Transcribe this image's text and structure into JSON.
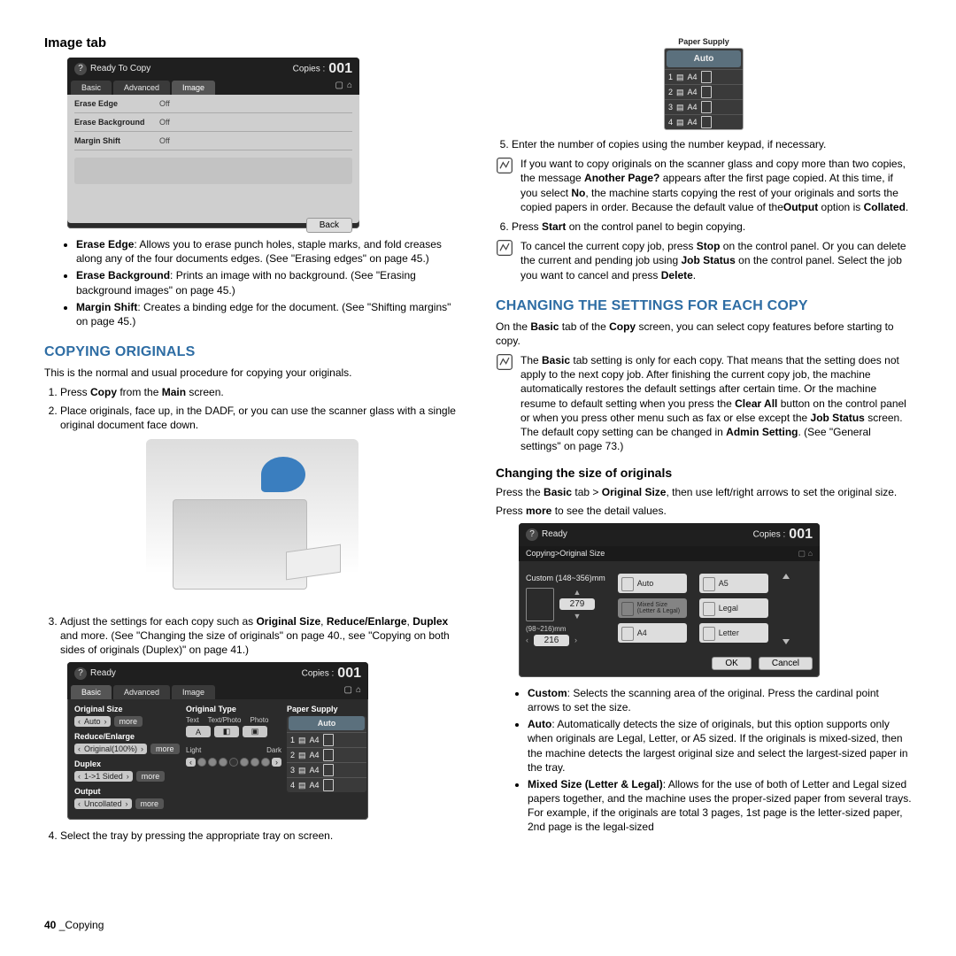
{
  "left": {
    "heading_image_tab": "Image tab",
    "lcd1": {
      "ready": "Ready To Copy",
      "copies_label": "Copies :",
      "copies_num": "001",
      "tab_basic": "Basic",
      "tab_advanced": "Advanced",
      "tab_image": "Image",
      "rows": [
        {
          "lbl": "Erase Edge",
          "val": "Off"
        },
        {
          "lbl": "Erase Background",
          "val": "Off"
        },
        {
          "lbl": "Margin Shift",
          "val": "Off"
        }
      ],
      "back": "Back"
    },
    "bullets_image": [
      {
        "b": "Erase Edge",
        "t": ": Allows you to erase punch holes, staple marks, and fold creases along any of the four documents edges. (See \"Erasing edges\" on page 45.)"
      },
      {
        "b": "Erase Background",
        "t": ": Prints an image with no background. (See \"Erasing background images\" on page 45.)"
      },
      {
        "b": "Margin Shift",
        "t": ": Creates a binding edge for the document. (See \"Shifting margins\" on page 45.)"
      }
    ],
    "heading_copying": "COPYING ORIGINALS",
    "intro_copying": "This is the normal and usual procedure for copying your originals.",
    "step1_a": "Press ",
    "step1_b": "Copy",
    "step1_c": " from the ",
    "step1_d": "Main",
    "step1_e": " screen.",
    "step2": "Place originals, face up, in the DADF, or you can use the scanner glass with a single original document face down.",
    "step3_a": "Adjust the settings for each copy such as ",
    "step3_b": "Original Size",
    "step3_c": ", ",
    "step3_d": "Reduce/Enlarge",
    "step3_e": ", ",
    "step3_f": "Duplex",
    "step3_g": " and more. (See \"Changing the size of originals\" on page 40., see \"Copying on both sides of originals (Duplex)\" on page 41.)",
    "lcd_basic": {
      "ready": "Ready",
      "copies_label": "Copies :",
      "copies_num": "001",
      "tab_basic": "Basic",
      "tab_advanced": "Advanced",
      "tab_image": "Image",
      "g_origsize": "Original Size",
      "v_auto": "Auto",
      "more": "more",
      "g_reduce": "Reduce/Enlarge",
      "v_reduce": "Original(100%)",
      "g_duplex": "Duplex",
      "v_duplex": "1->1 Sided",
      "g_output": "Output",
      "v_output": "Uncollated",
      "g_origtype": "Original Type",
      "t_text": "Text",
      "t_textphoto": "Text/Photo",
      "t_photo": "Photo",
      "light": "Light",
      "dark": "Dark",
      "g_papersupply": "Paper Supply",
      "auto": "Auto",
      "trays": [
        {
          "n": "1",
          "s": "A4"
        },
        {
          "n": "2",
          "s": "A4"
        },
        {
          "n": "3",
          "s": "A4"
        },
        {
          "n": "4",
          "s": "A4"
        }
      ]
    },
    "step4": "Select the tray by pressing the appropriate tray on screen."
  },
  "right": {
    "paper_supply": {
      "title": "Paper Supply",
      "auto": "Auto",
      "trays": [
        {
          "n": "1",
          "s": "A4"
        },
        {
          "n": "2",
          "s": "A4"
        },
        {
          "n": "3",
          "s": "A4"
        },
        {
          "n": "4",
          "s": "A4"
        }
      ]
    },
    "step5": "Enter the number of copies using the number keypad, if necessary.",
    "note1_a": "If you want to copy originals on the scanner glass and copy more than two copies, the message ",
    "note1_b": "Another Page?",
    "note1_c": " appears after the first page copied. At this time, if you select ",
    "note1_d": "No",
    "note1_e": ", the machine starts copying the rest of your originals and sorts the copied papers in order. Because the default value of the",
    "note1_f": "Output",
    "note1_g": " option is ",
    "note1_h": "Collated",
    "note1_i": ".",
    "step6_a": "Press ",
    "step6_b": "Start",
    "step6_c": " on the control panel to begin copying.",
    "note2_a": "To cancel the current copy job, press ",
    "note2_b": "Stop",
    "note2_c": " on the control panel. Or you can delete the current and pending job using ",
    "note2_d": "Job Status",
    "note2_e": " on the control panel. Select the job you want to cancel and press ",
    "note2_f": "Delete",
    "note2_g": ".",
    "heading_changing": "CHANGING THE SETTINGS FOR EACH COPY",
    "changing_a": "On the ",
    "changing_b": "Basic",
    "changing_c": " tab of the ",
    "changing_d": "Copy",
    "changing_e": " screen, you can select copy features before starting to copy.",
    "note3_a": "The ",
    "note3_b": "Basic",
    "note3_c": " tab setting is only for each copy. That means that the setting does not apply to the next copy job. After finishing the current copy job, the machine automatically restores the default settings after certain time. Or the machine resume to default setting when you press the ",
    "note3_d": "Clear All",
    "note3_e": " button on the control panel or when you press other menu such as fax or else except the ",
    "note3_f": "Job Status",
    "note3_g": " screen.",
    "note3_h": "The default copy setting can be changed in ",
    "note3_i": "Admin Setting",
    "note3_j": ". (See \"General settings\" on page 73.)",
    "heading_size": "Changing the size of originals",
    "size_a": "Press the ",
    "size_b": "Basic",
    "size_c": " tab > ",
    "size_d": "Original Size",
    "size_e": ", then use left/right arrows to set the original size.",
    "size_more_a": "Press ",
    "size_more_b": "more",
    "size_more_c": " to see the detail values.",
    "lcd_os": {
      "ready": "Ready",
      "copies_label": "Copies :",
      "copies_num": "001",
      "breadcrumb": "Copying>Original Size",
      "custom_title": "Custom (148~356)mm",
      "v1": "279",
      "v2_range": "(98~216)mm",
      "v2": "216",
      "btn_auto": "Auto",
      "btn_mixed": "Mixed Size (Letter & Legal)",
      "btn_a4": "A4",
      "btn_a5": "A5",
      "btn_legal": "Legal",
      "btn_letter": "Letter",
      "ok": "OK",
      "cancel": "Cancel"
    },
    "bullets_size": [
      {
        "b": "Custom",
        "t": ": Selects the scanning area of the original. Press the cardinal point arrows to set the size."
      },
      {
        "b": "Auto",
        "t": ": Automatically detects the size of originals, but this option supports only when originals are Legal, Letter, or A5 sized. If the originals is mixed-sized, then the machine detects the largest original size and select the largest-sized paper in the tray."
      },
      {
        "b": "Mixed Size (Letter & Legal)",
        "t": ": Allows for the use of both of Letter and Legal sized papers together, and the machine uses the proper-sized paper from several trays. For example, if the originals are total 3 pages, 1st page is the letter-sized paper, 2nd page is the legal-sized"
      }
    ]
  },
  "footer_num": "40",
  "footer_text": " _Copying"
}
